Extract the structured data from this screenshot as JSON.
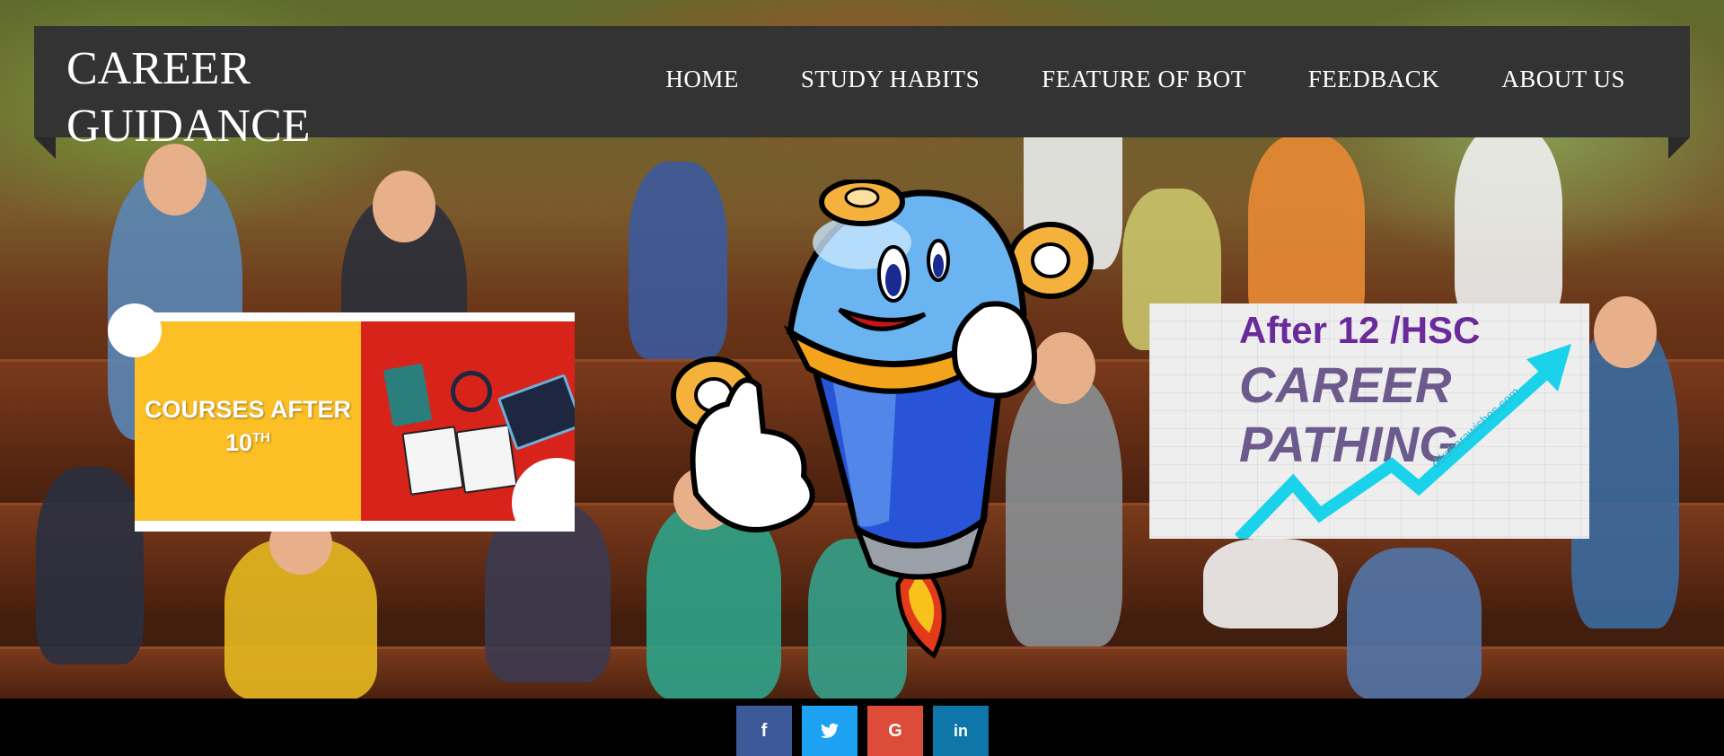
{
  "header": {
    "logo_line1": "CAREER",
    "logo_line2": "GUIDANCE",
    "nav": [
      {
        "label": "HOME"
      },
      {
        "label": "STUDY HABITS"
      },
      {
        "label": "FEATURE OF BOT"
      },
      {
        "label": "FEEDBACK"
      },
      {
        "label": "ABOUT US"
      }
    ]
  },
  "cards": {
    "left": {
      "title_line1": "COURSES AFTER",
      "title_num": "10",
      "title_sup": "TH"
    },
    "right": {
      "line1": "After 12 /HSC",
      "line2": "CAREER",
      "line3": "PATHING",
      "watermark": "diksharawishes.com"
    }
  },
  "social": [
    {
      "icon": "facebook-icon",
      "glyph": "f",
      "color": "#3b5998"
    },
    {
      "icon": "twitter-icon",
      "glyph": "🐦",
      "color": "#1da1f2"
    },
    {
      "icon": "google-icon",
      "glyph": "G",
      "color": "#dd4b39"
    },
    {
      "icon": "linkedin-icon",
      "glyph": "in",
      "color": "#0e76a8"
    }
  ],
  "colors": {
    "header_bg": "#333333",
    "card_yellow": "#fcbf26",
    "card_red": "#d8231a",
    "hsc_purple": "#6a2a9a",
    "arrow_cyan": "#1ad3ea"
  }
}
